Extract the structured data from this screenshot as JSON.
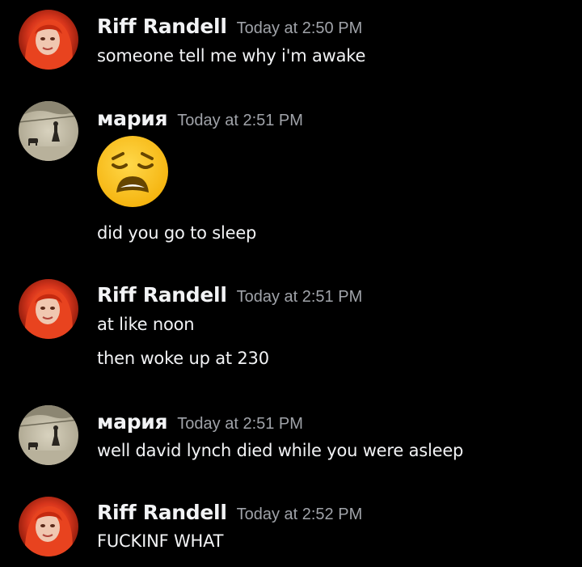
{
  "colors": {
    "background": "#000000",
    "username": "#f2f3f5",
    "timestamp": "#a0a3a9",
    "message": "#f2f3f5"
  },
  "messages": [
    {
      "author": "Riff Randell",
      "time": "Today at 2:50 PM",
      "avatar": "red-hair-avatar",
      "lines": [
        "someone tell me why i'm awake"
      ]
    },
    {
      "author": "мария",
      "time": "Today at 2:51 PM",
      "avatar": "sepia-landscape-avatar",
      "emoji": "weary-face-emoji",
      "lines": [
        "did you go to sleep"
      ]
    },
    {
      "author": "Riff Randell",
      "time": "Today at 2:51 PM",
      "avatar": "red-hair-avatar",
      "lines": [
        "at like noon",
        "then woke up at 230"
      ]
    },
    {
      "author": "мария",
      "time": "Today at 2:51 PM",
      "avatar": "sepia-landscape-avatar",
      "lines": [
        "well david lynch died while you were asleep"
      ]
    },
    {
      "author": "Riff Randell",
      "time": "Today at 2:52 PM",
      "avatar": "red-hair-avatar",
      "lines": [
        "FUCKINF WHAT"
      ]
    }
  ]
}
